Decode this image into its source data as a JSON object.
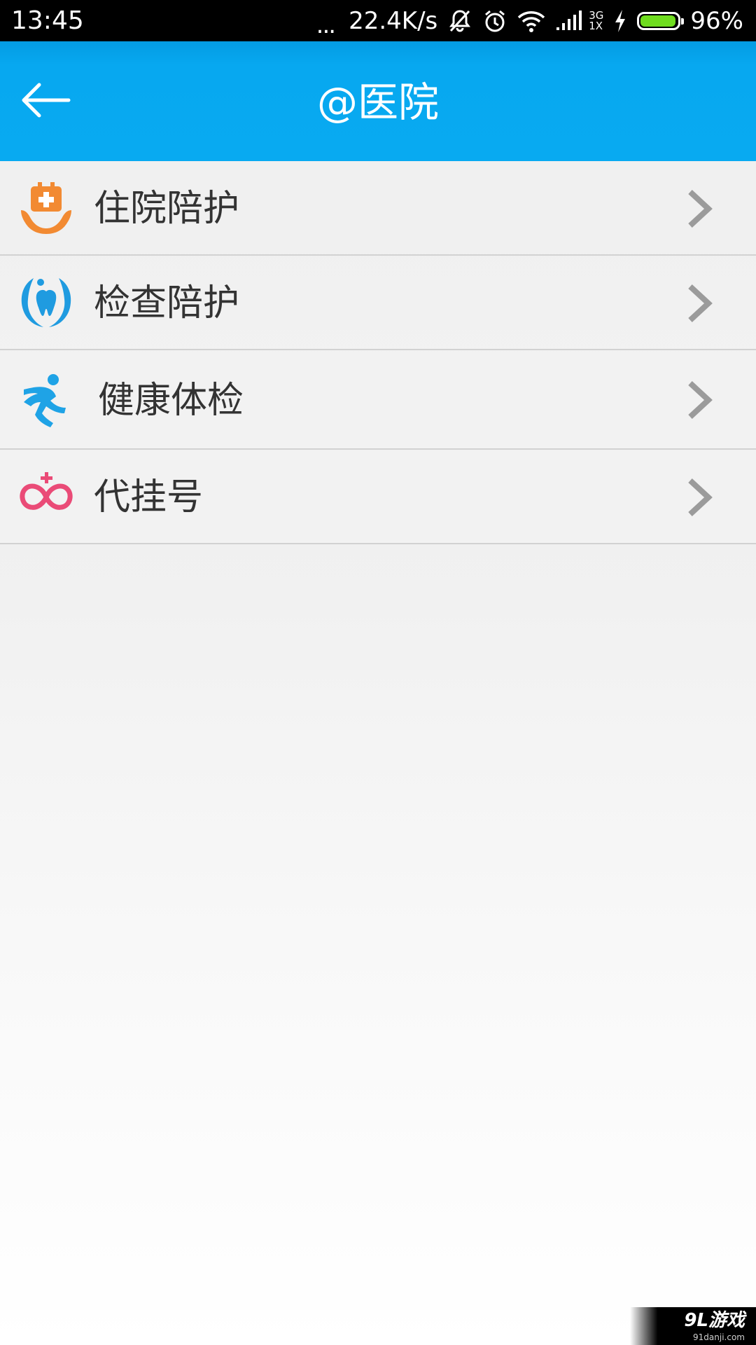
{
  "status_bar": {
    "time": "13:45",
    "dots": "...",
    "speed": "22.4K/s",
    "network_top": "3G",
    "network_bottom": "1X",
    "battery_percent": "96%",
    "battery_level": 0.96,
    "battery_color": "#6fdc1f"
  },
  "header": {
    "title": "@医院",
    "back_icon": "arrow-left-icon",
    "background_color": "#08aaf1"
  },
  "menu": {
    "items": [
      {
        "label": "住院陪护",
        "icon": "hospital-care-icon",
        "icon_color": "#f28a32"
      },
      {
        "label": "检查陪护",
        "icon": "checkup-care-icon",
        "icon_color": "#1f9be0"
      },
      {
        "label": "健康体检",
        "icon": "running-person-icon",
        "icon_color": "#1fa3e6"
      },
      {
        "label": "代挂号",
        "icon": "registration-icon",
        "icon_color": "#ea4b77"
      }
    ]
  },
  "watermark": {
    "logo": "9L游戏",
    "url": "91danji.com"
  }
}
